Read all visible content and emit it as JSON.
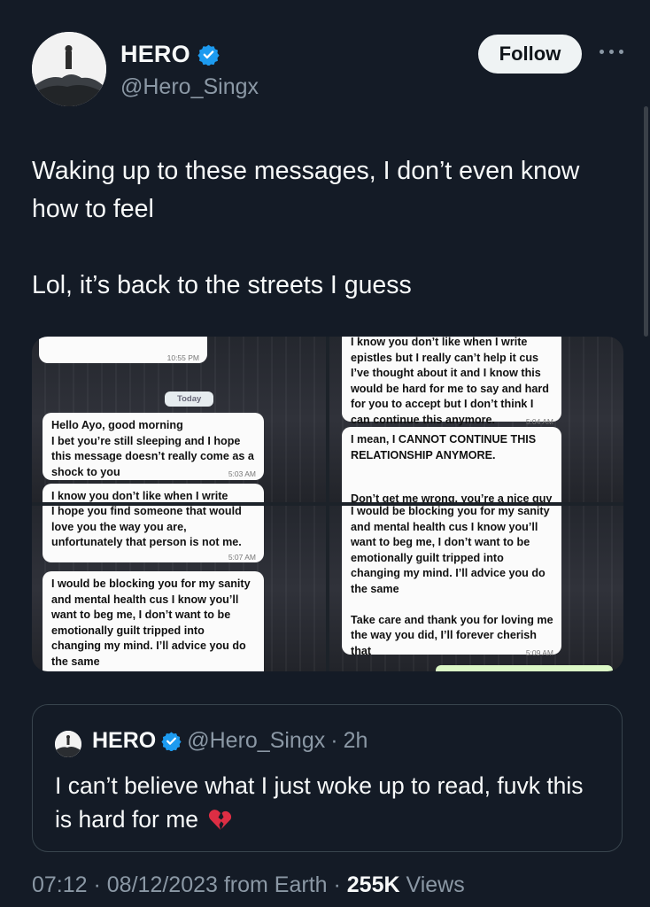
{
  "author": {
    "name": "HERO",
    "handle": "@Hero_Singx",
    "verified": true,
    "verified_color": "#1d9bf0"
  },
  "follow_label": "Follow",
  "tweet": {
    "line1": "Waking up to these messages, I don’t even know how to feel",
    "line2": "Lol, it’s back to the streets I guess"
  },
  "media": {
    "pane1": {
      "time_top": "10:55 PM",
      "chip": "Today",
      "msg1": "Hello Ayo, good morning\nI bet you’re still sleeping and I hope this message doesn’t really come as a shock to you",
      "msg1_time": "5:03 AM",
      "msg2": "I know you don’t like when I write"
    },
    "pane2": {
      "msg1": "I know you don’t like when I write epistles but I really can’t help it cus I’ve thought about it and I know this would be hard for me to say and hard for you to accept but I don’t think I can continue this anymore.",
      "msg1_time": "5:04 AM",
      "msg2": "I mean, I CANNOT CONTINUE THIS RELATIONSHIP ANYMORE.",
      "msg2_tail": "Don’t get me wrong, you’re a nice guy"
    },
    "pane3": {
      "msg1": "I hope you find someone that would love you the way you are, unfortunately that person is not me.",
      "msg1_time": "5:07 AM",
      "msg2": "I would be blocking you for my sanity and mental health cus I know you’ll want to beg me, I don’t want to be emotionally guilt tripped into changing my mind. I’ll advice you do the same"
    },
    "pane4": {
      "msg1": "I would be blocking you for my sanity and mental health cus I know you’ll want to beg me, I don’t want to be emotionally guilt tripped into changing my mind. I’ll advice you do the same\n\nTake care and thank you for loving me the way you did, I’ll forever cherish that",
      "msg1_time": "5:09 AM"
    }
  },
  "quote": {
    "name": "HERO",
    "handle": "@Hero_Singx",
    "dot": "·",
    "time": "2h",
    "text": "I can’t believe what I just woke up to read, fuvk this is hard for me",
    "emoji": "broken-heart-icon"
  },
  "meta": {
    "time": "07:12",
    "date": "08/12/2023",
    "location": "from Earth",
    "views_count": "255K",
    "views_label": "Views"
  }
}
